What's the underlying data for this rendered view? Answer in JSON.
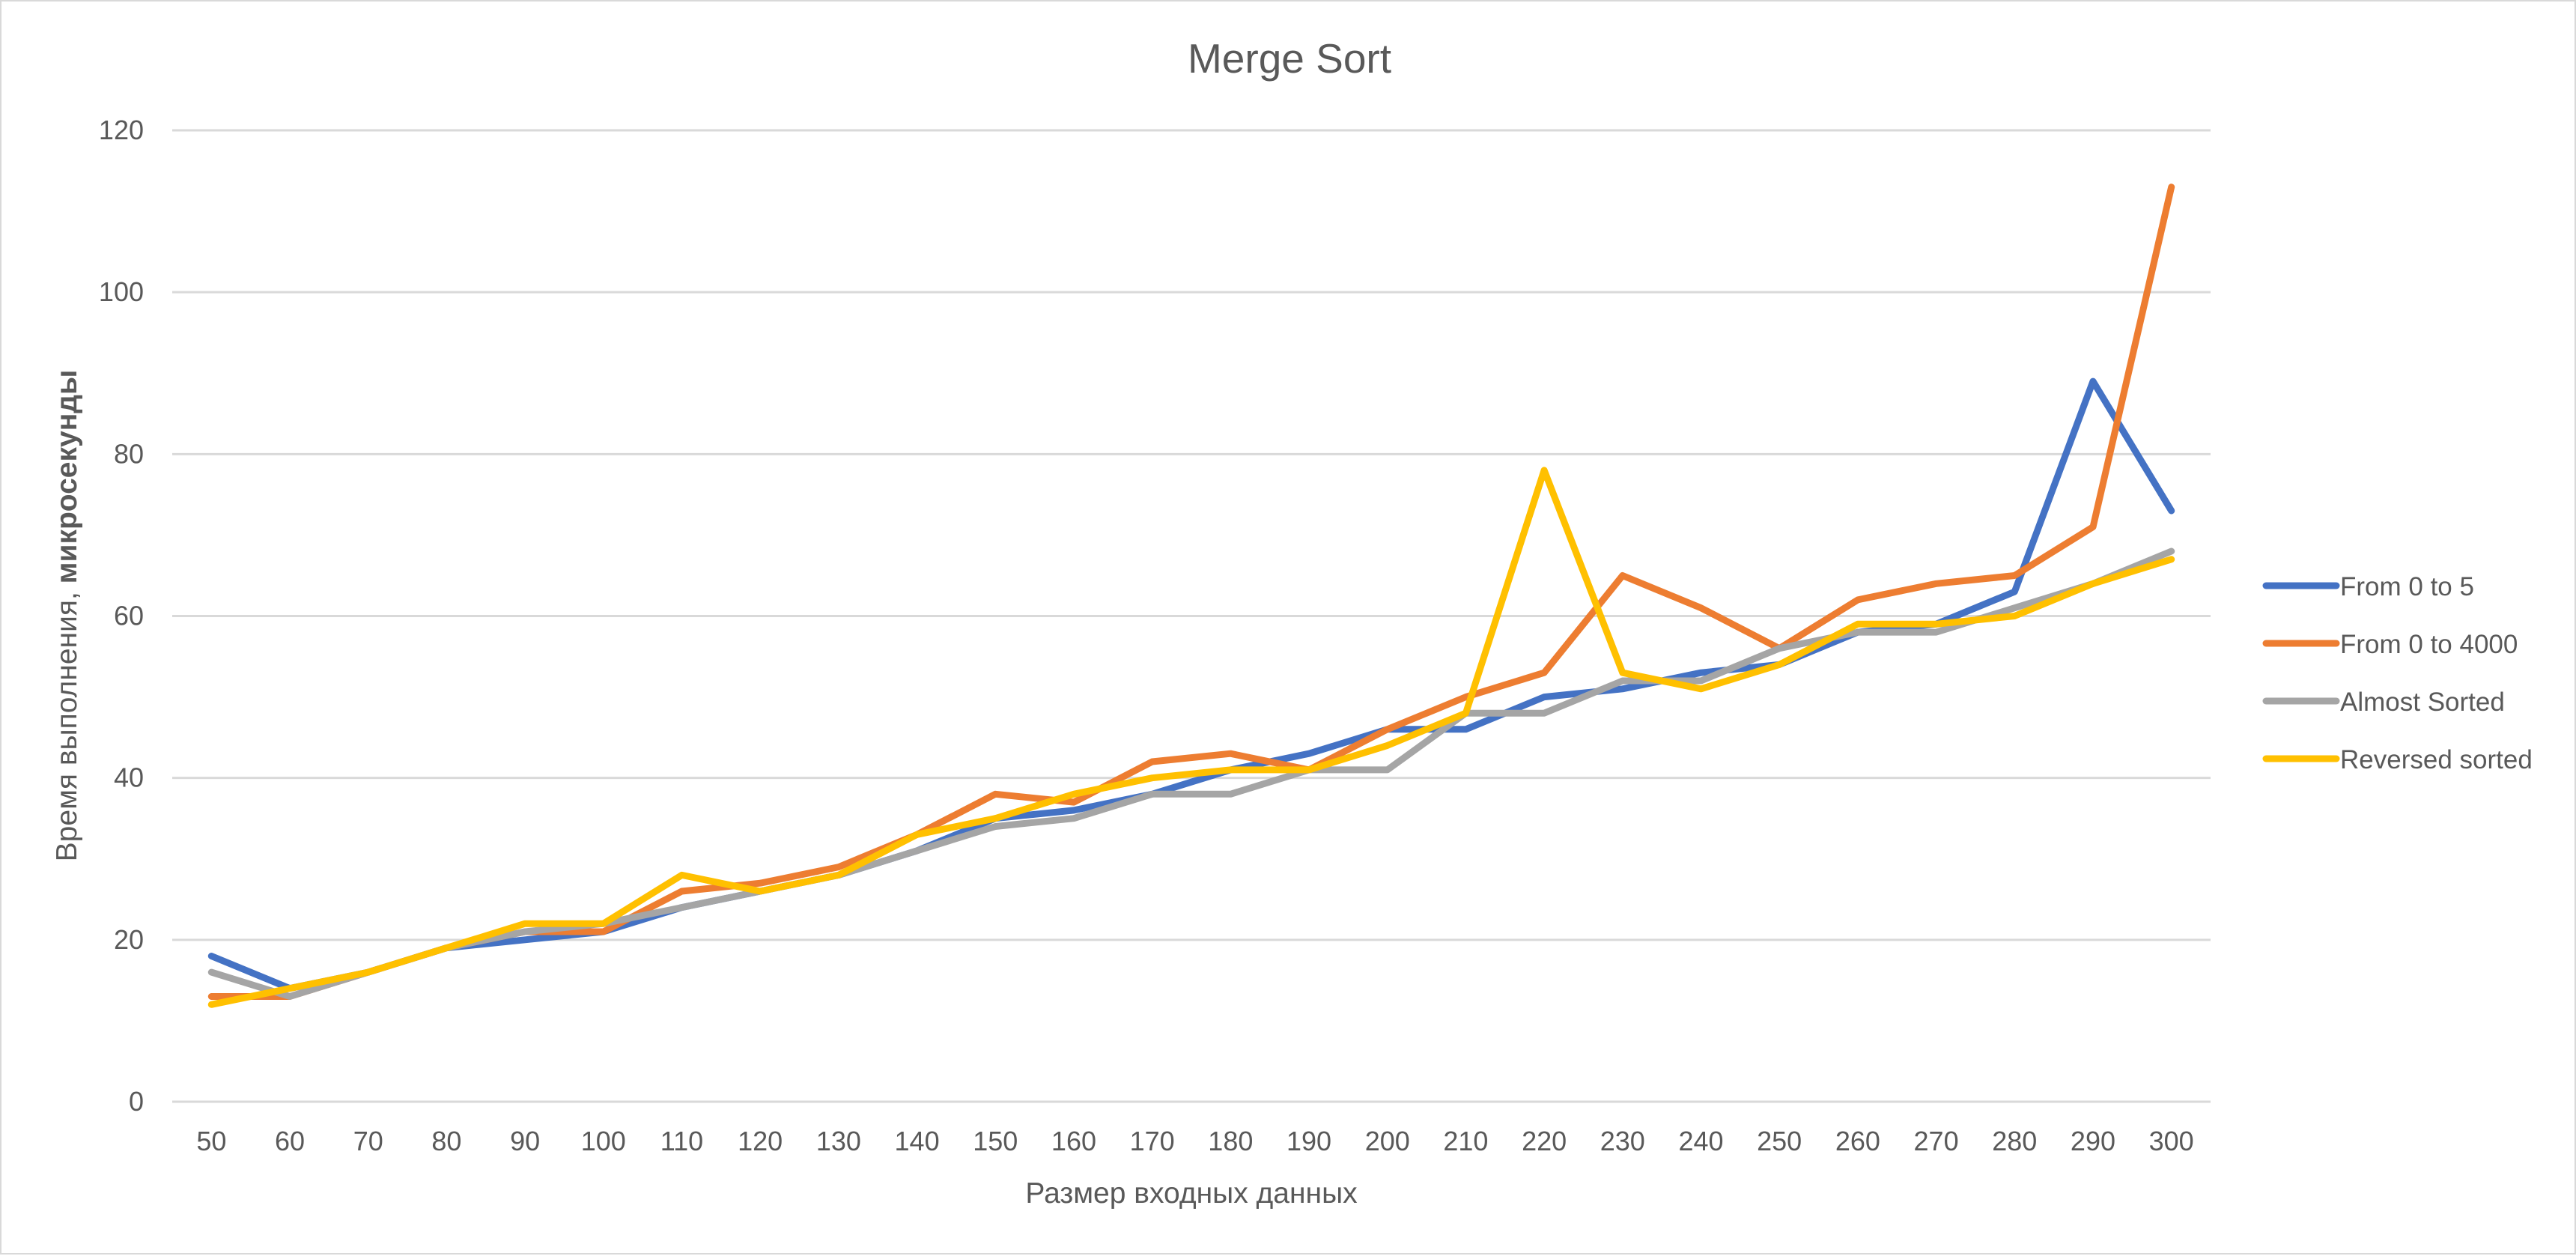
{
  "chart_data": {
    "type": "line",
    "title": "Merge Sort",
    "xlabel": "Размер входных данных",
    "ylabel": "Время выполнения, микросекунды",
    "ylabel_parts": [
      {
        "text": "Время выполнения, ",
        "bold": false
      },
      {
        "text": "микросекунды",
        "bold": true
      }
    ],
    "categories": [
      "50",
      "60",
      "70",
      "80",
      "90",
      "100",
      "110",
      "120",
      "130",
      "140",
      "150",
      "160",
      "170",
      "180",
      "190",
      "200",
      "210",
      "220",
      "230",
      "240",
      "250",
      "260",
      "270",
      "280",
      "290",
      "300"
    ],
    "ylim": [
      0,
      120
    ],
    "yticks": [
      "0",
      "20",
      "40",
      "60",
      "80",
      "100",
      "120"
    ],
    "ytick_values": [
      0,
      20,
      40,
      60,
      80,
      100,
      120
    ],
    "grid": true,
    "legend_position": "right",
    "series": [
      {
        "name": "From 0 to 5",
        "color": "#4472c4",
        "values": [
          18,
          14,
          16,
          19,
          20,
          21,
          24,
          26,
          28,
          31,
          35,
          36,
          38,
          41,
          43,
          46,
          46,
          50,
          51,
          53,
          54,
          58,
          59,
          63,
          89,
          73
        ]
      },
      {
        "name": "From 0 to 4000",
        "color": "#ed7d31",
        "values": [
          13,
          13,
          16,
          19,
          21,
          21,
          26,
          27,
          29,
          33,
          38,
          37,
          42,
          43,
          41,
          46,
          50,
          53,
          65,
          61,
          56,
          62,
          64,
          65,
          71,
          113
        ]
      },
      {
        "name": "Almost Sorted",
        "color": "#a5a5a5",
        "values": [
          16,
          13,
          16,
          19,
          21,
          22,
          24,
          26,
          28,
          31,
          34,
          35,
          38,
          38,
          41,
          41,
          48,
          48,
          52,
          52,
          56,
          58,
          58,
          61,
          64,
          68
        ]
      },
      {
        "name": "Reversed sorted",
        "color": "#ffc000",
        "values": [
          12,
          14,
          16,
          19,
          22,
          22,
          28,
          26,
          28,
          33,
          35,
          38,
          40,
          41,
          41,
          44,
          48,
          78,
          53,
          51,
          54,
          59,
          59,
          60,
          64,
          67
        ]
      }
    ]
  }
}
